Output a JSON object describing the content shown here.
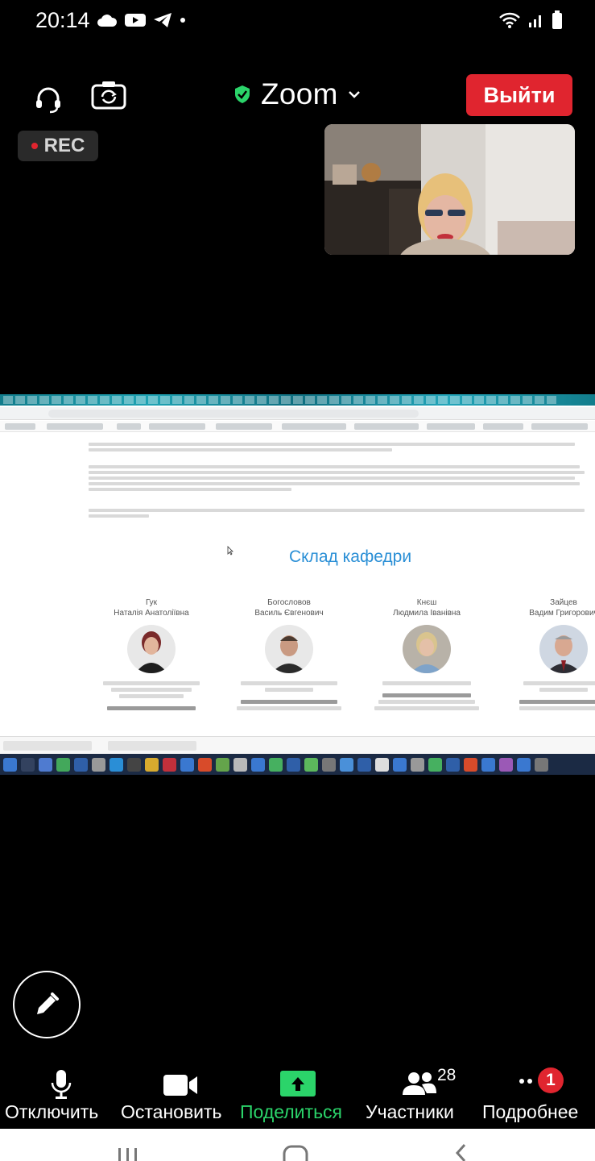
{
  "status_bar": {
    "time": "20:14",
    "left_icons": [
      "cloud-icon",
      "youtube-icon",
      "telegram-icon",
      "dot-icon"
    ],
    "right_icons": [
      "wifi-icon",
      "signal-icon",
      "battery-icon"
    ]
  },
  "top_bar": {
    "title": "Zoom",
    "exit_label": "Выйти",
    "rec_label": "REC"
  },
  "shared_screen": {
    "heading": "Склад кафедри",
    "staff": [
      {
        "surname": "Гук",
        "name": "Наталія Анатоліївна"
      },
      {
        "surname": "Богословов",
        "name": "Василь Євгенович"
      },
      {
        "surname": "Кнєш",
        "name": "Людмила Іванівна"
      },
      {
        "surname": "Зайцев",
        "name": "Вадим Григорович"
      }
    ]
  },
  "toolbar": {
    "mute_label": "Отключить",
    "stop_video_label": "Остановить",
    "share_label": "Поделиться",
    "participants_label": "Участники",
    "participants_count": "28",
    "more_label": "Подробнее",
    "more_badge": "1"
  },
  "colors": {
    "exit_red": "#e0252f",
    "share_green": "#2bd46a",
    "heading_blue": "#2a8fd6"
  }
}
